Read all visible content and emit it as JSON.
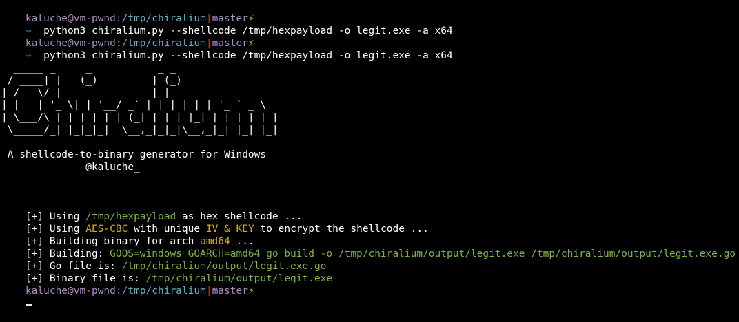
{
  "prompt": {
    "user": "kaluche",
    "at": "@",
    "host": "vm-pwnd",
    "colon": ":",
    "path": "/tmp/chiralium",
    "pipe": "|",
    "branch": "master",
    "bolt": "⚡"
  },
  "commands": [
    {
      "arrow": "⇒",
      "text": "  python3 chiralium.py --shellcode /tmp/hexpayload -o legit.exe -a x64"
    },
    {
      "arrow": "⇒",
      "text": "  python3 chiralium.py --shellcode /tmp/hexpayload -o legit.exe -a x64"
    }
  ],
  "banner": {
    "ascii": [
      "  _____ _     _           _ _",
      " / ____| |   (_)         | (_)",
      "| /   \\/ |__  _ _ __ __ _| |_ _   _ _ __ ___",
      "| |   | '_ \\| | '__/ _` | | | | | | '_ ` _ \\",
      "| \\___/\\ | | | | | | (_| | | | |_| | | | | | |",
      " \\_____/_| |_|_|_|  \\__,_|_|_|\\__,_|_| |_| |_|"
    ],
    "tagline": " A shellcode-to-binary generator for Windows",
    "author": "              @kaluche_"
  },
  "log": [
    {
      "prefix": "[+] Using ",
      "hl": "/tmp/hexpayload",
      "hl_color": "green",
      "suffix": " as hex shellcode ..."
    },
    {
      "prefix": "[+] Using ",
      "hl": "AES-CBC",
      "hl_color": "yellow",
      "mid": " with unique ",
      "hl2": "IV & KEY",
      "hl2_color": "yellow",
      "suffix": " to encrypt the shellcode ..."
    },
    {
      "prefix": "[+] Building binary for arch ",
      "hl": "amd64",
      "hl_color": "yellow",
      "suffix": " ..."
    },
    {
      "prefix": "[+] Building: ",
      "hl": "GOOS=windows GOARCH=amd64 go build -o /tmp/chiralium/output/legit.exe /tmp/chiralium/output/legit.exe.go",
      "hl_color": "green",
      "suffix": ""
    },
    {
      "prefix": "[+] Go file is: ",
      "hl": "/tmp/chiralium/output/legit.exe.go",
      "hl_color": "green",
      "suffix": ""
    },
    {
      "prefix": "[+] Binary file is: ",
      "hl": "/tmp/chiralium/output/legit.exe",
      "hl_color": "green",
      "suffix": ""
    }
  ],
  "colors": {
    "background": "#000000",
    "prompt": "#a98bc4",
    "path": "#5fb3c7",
    "pipe": "#c0392b",
    "bolt": "#f1c40f",
    "arrow": "#2e86c1",
    "green": "#7cb342",
    "yellow": "#d4b106"
  }
}
